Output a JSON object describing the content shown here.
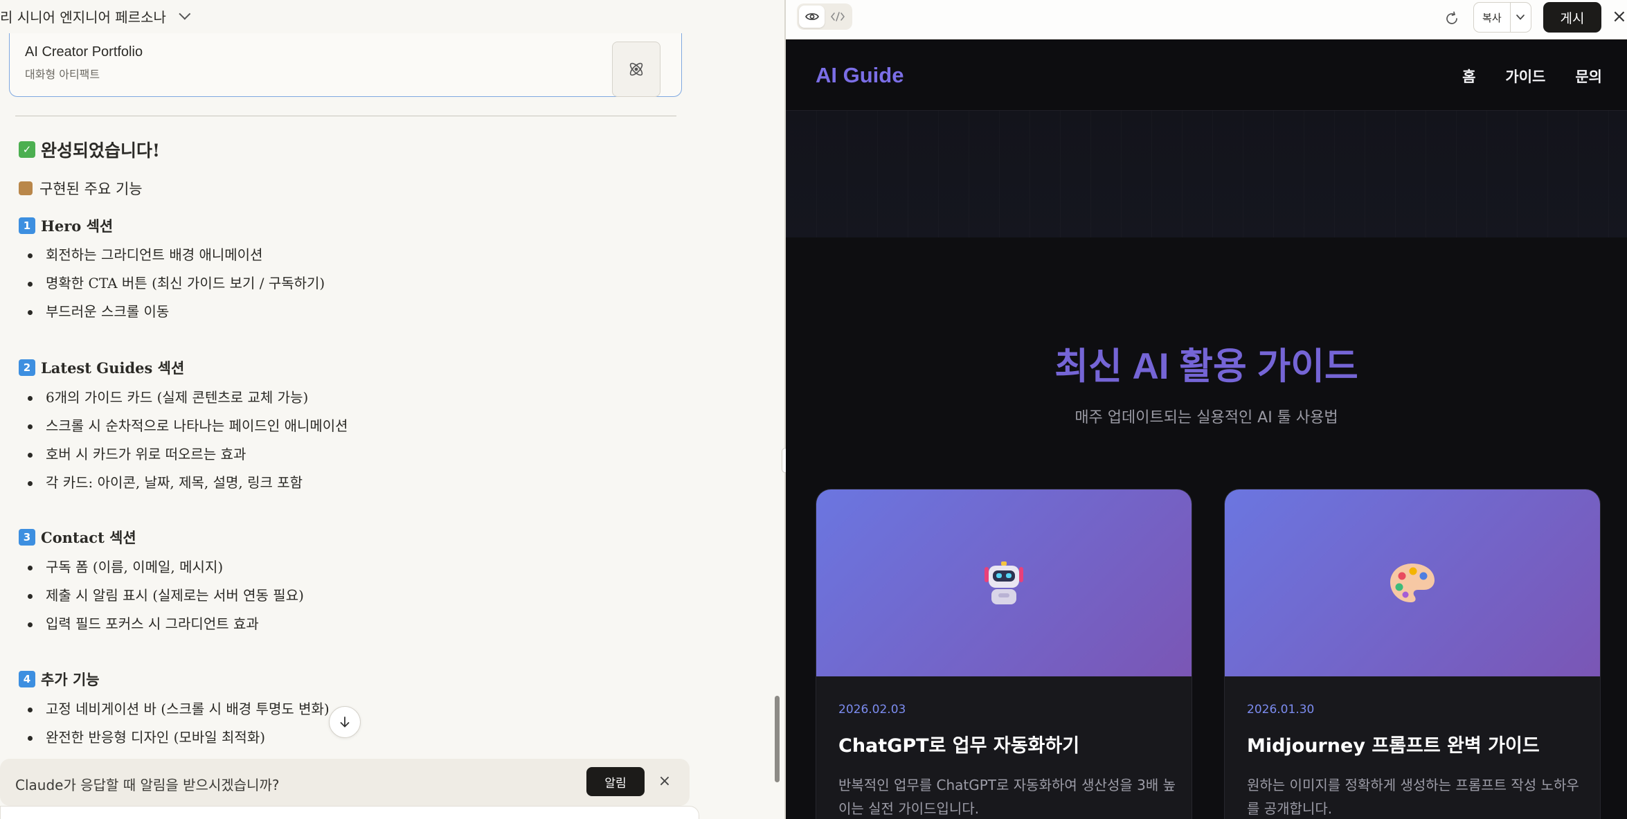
{
  "chat": {
    "title": "리 시니어 엔지니어 페르소나",
    "artifact": {
      "title": "AI Creator Portfolio",
      "subtitle": "대화형 아티팩트"
    },
    "heading": "완성되었습니다!",
    "subheading": "구현된 주요 기능",
    "sections": [
      {
        "num": "1",
        "title": "Hero 섹션",
        "items": [
          "회전하는 그라디언트 배경 애니메이션",
          "명확한 CTA 버튼 (최신 가이드 보기 / 구독하기)",
          "부드러운 스크롤 이동"
        ]
      },
      {
        "num": "2",
        "title": "Latest Guides 섹션",
        "items": [
          "6개의 가이드 카드 (실제 콘텐츠로 교체 가능)",
          "스크롤 시 순차적으로 나타나는 페이드인 애니메이션",
          "호버 시 카드가 위로 떠오르는 효과",
          "각 카드: 아이콘, 날짜, 제목, 설명, 링크 포함"
        ]
      },
      {
        "num": "3",
        "title": "Contact 섹션",
        "items": [
          "구독 폼 (이름, 이메일, 메시지)",
          "제출 시 알림 표시 (실제로는 서버 연동 필요)",
          "입력 필드 포커스 시 그라디언트 효과"
        ]
      },
      {
        "num": "4",
        "title": "추가 기능",
        "items": [
          "고정 네비게이션 바 (스크롤 시 배경 투명도 변화)",
          "완전한 반응형 디자인 (모바일 최적화)"
        ]
      }
    ],
    "notify": {
      "text": "Claude가 응답할 때 알림을 받으시겠습니까?",
      "button": "알림",
      "close": "×"
    }
  },
  "toolbar": {
    "copy": "복사",
    "publish": "게시",
    "close": "×"
  },
  "site": {
    "brand": "AI Guide",
    "nav": [
      "홈",
      "가이드",
      "문의"
    ],
    "guides_title": "최신 AI 활용 가이드",
    "guides_subtitle": "매주 업데이트되는 실용적인 AI 툴 사용법",
    "cards": [
      {
        "icon": "robot-icon",
        "date": "2026.02.03",
        "title": "ChatGPT로 업무 자동화하기",
        "desc": "반복적인 업무를 ChatGPT로 자동화하여 생산성을 3배 높이는 실전 가이드입니다."
      },
      {
        "icon": "palette-icon",
        "date": "2026.01.30",
        "title": "Midjourney 프롬프트 완벽 가이드",
        "desc": "원하는 이미지를 정확하게 생성하는 프롬프트 작성 노하우를 공개합니다."
      }
    ]
  },
  "colors": {
    "accent": "#7565d6",
    "card_gradient_start": "#6b76e0",
    "card_gradient_end": "#7a56b5",
    "date": "#7c8cf0"
  }
}
